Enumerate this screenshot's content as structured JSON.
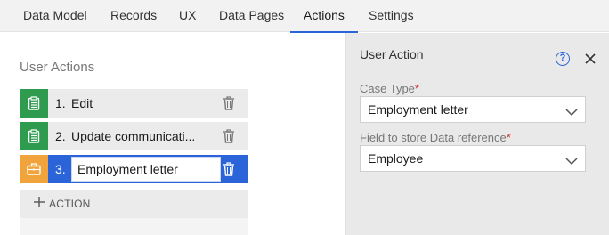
{
  "tabs": [
    {
      "label": "Data Model",
      "active": false
    },
    {
      "label": "Records",
      "active": false
    },
    {
      "label": "UX",
      "active": false
    },
    {
      "label": "Data Pages",
      "active": false
    },
    {
      "label": "Actions",
      "active": true
    },
    {
      "label": "Settings",
      "active": false
    }
  ],
  "left_panel": {
    "title": "User Actions",
    "actions": [
      {
        "number": "1.",
        "name": "Edit",
        "icon": "clipboard-icon",
        "color": "#2e9b4f"
      },
      {
        "number": "2.",
        "name": "Update communicati...",
        "icon": "clipboard-icon",
        "color": "#2e9b4f"
      },
      {
        "number": "3.",
        "name": "Employment letter",
        "icon": "briefcase-icon",
        "color": "#f0a43b",
        "selected": true
      }
    ],
    "add_label": "ACTION"
  },
  "right_panel": {
    "title": "User Action",
    "case_type": {
      "label": "Case Type",
      "required_mark": "*",
      "value": "Employment letter"
    },
    "data_reference": {
      "label": "Field to store Data reference",
      "required_mark": "*",
      "value": "Employee"
    }
  },
  "colors": {
    "accent": "#2b64d8",
    "green": "#2e9b4f",
    "orange": "#f0a43b",
    "required": "#d32f2f"
  }
}
